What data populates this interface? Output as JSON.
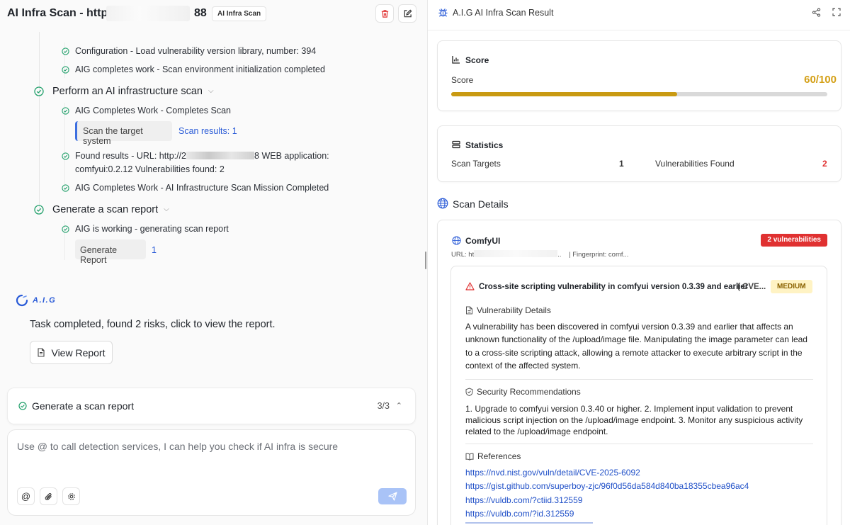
{
  "left": {
    "title_prefix": "AI Infra Scan - http://",
    "title_suffix": "88",
    "tag": "AI Infra Scan",
    "steps": {
      "config": "Configuration - Load vulnerability version library, number: 394",
      "init": "AIG completes work - Scan environment initialization completed",
      "perform_section": "Perform an AI infrastructure scan",
      "completes_scan": "AIG Completes Work - Completes Scan",
      "scan_target_tool": "Scan the target system",
      "scan_results_link": "Scan results: 1",
      "found_line1_pre": "Found results - URL: http://2",
      "found_line1_post": "8 WEB application:",
      "found_line2": "comfyui:0.2.12 Vulnerabilities found: 2",
      "mission_done": "AIG Completes Work - AI Infrastructure Scan Mission Completed",
      "report_section": "Generate a scan report",
      "generating": "AIG is working - generating scan report",
      "generate_tool": "Generate Report",
      "generate_count": "1"
    },
    "aig_logo": "A.I.G",
    "completed_text": "Task completed, found 2 risks, click to view the report.",
    "view_report": "View Report",
    "status": {
      "label": "Generate a scan report",
      "count": "3/3"
    },
    "input": {
      "placeholder": "Use @ to call detection services, I can help you check if AI infra is secure"
    }
  },
  "right": {
    "title": "A.I.G AI Infra Scan Result",
    "score": {
      "heading": "Score",
      "label": "Score",
      "value": "60/100",
      "fraction": 0.6
    },
    "statistics": {
      "heading": "Statistics",
      "scan_targets_label": "Scan Targets",
      "scan_targets_value": "1",
      "vulns_label": "Vulnerabilities Found",
      "vulns_value": "2"
    },
    "details": {
      "heading": "Scan Details",
      "target_name": "ComfyUI",
      "vuln_badge": "2 vulnerabilities",
      "url_prefix": "URL: ht",
      "url_suffix": "..",
      "fingerprint": "| Fingerprint: comf...",
      "vuln": {
        "title": "Cross-site scripting vulnerability in comfyui version 0.3.39 and earlier",
        "cve": "( CVE...",
        "severity": "MEDIUM",
        "details_heading": "Vulnerability Details",
        "details_text": "A vulnerability has been discovered in comfyui version 0.3.39 and earlier that affects an unknown functionality of the /upload/image file. Manipulating the image parameter can lead to a cross-site scripting attack, allowing a remote attacker to execute arbitrary script in the context of the affected system.",
        "recs_heading": "Security Recommendations",
        "recs_text": "1. Upgrade to comfyui version 0.3.40 or higher. 2. Implement input validation to prevent malicious script injection on the /upload/image endpoint. 3. Monitor any suspicious activity related to the /upload/image endpoint.",
        "refs_heading": "References",
        "refs": [
          "https://nvd.nist.gov/vuln/detail/CVE-2025-6092",
          "https://gist.github.com/superboy-zjc/96f0d56da584d840ba18355cbea96ac4",
          "https://vuldb.com/?ctiid.312559",
          "https://vuldb.com/?id.312559"
        ]
      }
    }
  },
  "colors": {
    "accent": "#2a5bd7",
    "success": "#22a06b",
    "danger": "#e03131",
    "warning": "#d4a017"
  }
}
